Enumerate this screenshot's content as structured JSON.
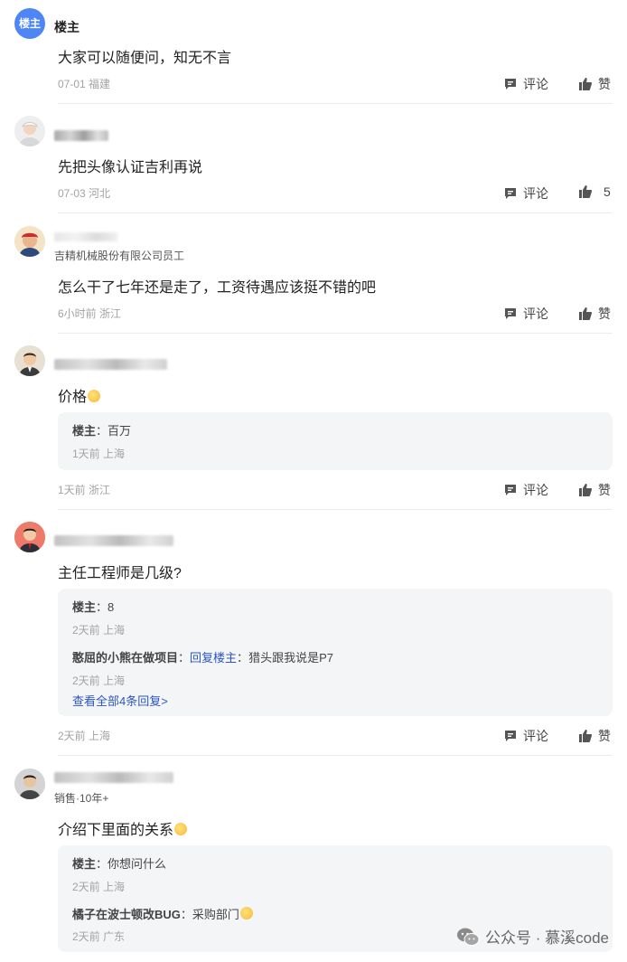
{
  "comments": [
    {
      "badge": "楼主",
      "name": "楼主",
      "text": "大家可以随便问，知无不言",
      "meta": "07-01 福建",
      "comment_label": "评论",
      "like_label": "赞"
    },
    {
      "text": "先把头像认证吉利再说",
      "meta": "07-03 河北",
      "comment_label": "评论",
      "like_label": "5"
    },
    {
      "subtitle": "吉精机械股份有限公司员工",
      "text": "怎么干了七年还是走了，工资待遇应该挺不错的吧",
      "meta": "6小时前 浙江",
      "comment_label": "评论",
      "like_label": "赞"
    },
    {
      "text": "价格",
      "replies": [
        {
          "author": "楼主",
          "sep": "：",
          "content": "百万",
          "meta": "1天前 上海"
        }
      ],
      "meta": "1天前 浙江",
      "comment_label": "评论",
      "like_label": "赞"
    },
    {
      "text": "主任工程师是几级?",
      "replies": [
        {
          "author": "楼主",
          "sep": "：",
          "content": "8",
          "meta": "2天前 上海"
        },
        {
          "author": "憨屈的小熊在做项目",
          "sep": "：",
          "reply_to": "回复楼主",
          "sep2": "：",
          "content": "猎头跟我说是P7",
          "meta": "2天前 上海"
        }
      ],
      "view_all": "查看全部4条回复>",
      "meta": "2天前 上海",
      "comment_label": "评论",
      "like_label": "赞"
    },
    {
      "subtitle": "销售·10年+",
      "text": "介绍下里面的关系",
      "replies": [
        {
          "author": "楼主",
          "sep": "：",
          "content": "你想问什么",
          "meta": "2天前 上海"
        },
        {
          "author": "橘子在波士顿改BUG",
          "sep": "：",
          "content": "采购部门",
          "meta": "2天前 广东"
        }
      ]
    }
  ],
  "watermark": {
    "text": "公众号 · 慕溪code",
    "icon": "wechat-icon"
  },
  "colors": {
    "accent_blue": "#2b56c5",
    "badge_blue": "#4e86f5",
    "reply_bg": "#f4f5f7",
    "meta_gray": "#a3a3a3"
  }
}
